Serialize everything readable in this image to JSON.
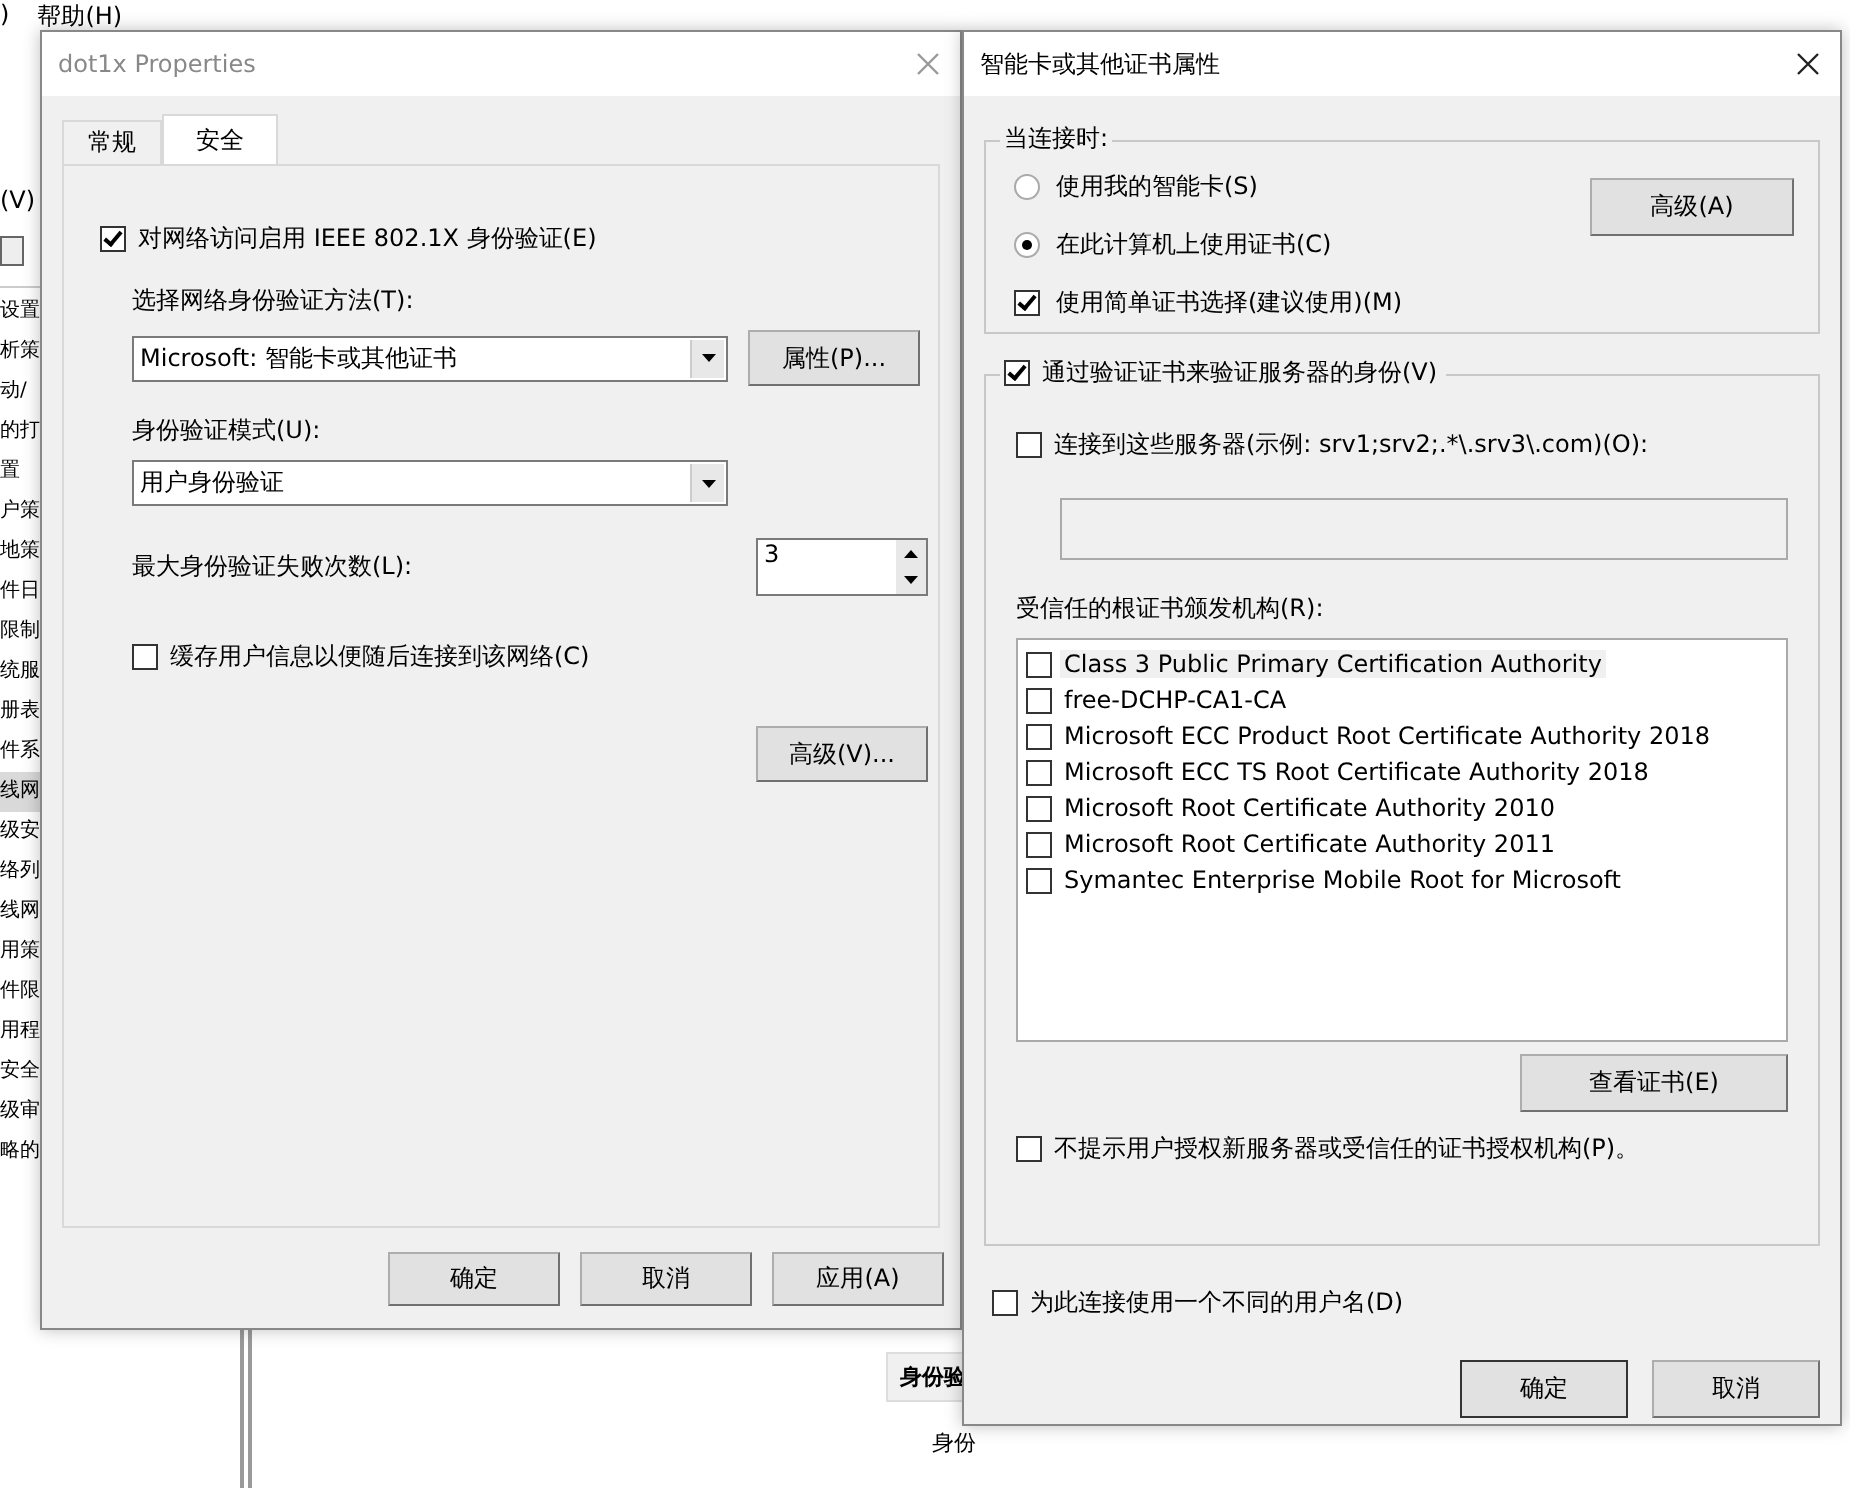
{
  "background_window": {
    "menu": [
      ")",
      "帮助(H)"
    ],
    "view_menu": "(V)",
    "tree_items": [
      {
        "label": "设置",
        "selected": false
      },
      {
        "label": "析策",
        "selected": false
      },
      {
        "label": "动/",
        "selected": false
      },
      {
        "label": "的打",
        "selected": false
      },
      {
        "label": "置",
        "selected": false
      },
      {
        "label": "户策",
        "selected": false
      },
      {
        "label": "地策",
        "selected": false
      },
      {
        "label": "件日",
        "selected": false
      },
      {
        "label": "限制",
        "selected": false
      },
      {
        "label": "统服",
        "selected": false
      },
      {
        "label": "册表",
        "selected": false
      },
      {
        "label": "件系",
        "selected": false
      },
      {
        "label": "线网",
        "selected": true
      },
      {
        "label": "级安",
        "selected": false
      },
      {
        "label": "络列",
        "selected": false
      },
      {
        "label": "线网",
        "selected": false
      },
      {
        "label": "用策",
        "selected": false
      },
      {
        "label": "件限",
        "selected": false
      },
      {
        "label": "用程",
        "selected": false
      },
      {
        "label": "安全",
        "selected": false
      },
      {
        "label": "级审",
        "selected": false
      },
      {
        "label": "略的",
        "selected": false
      }
    ],
    "table_header": "身份验",
    "table_cell": "身份"
  },
  "dialog1": {
    "title": "dot1x Properties",
    "tabs": [
      {
        "label": "常规",
        "selected": false
      },
      {
        "label": "安全",
        "selected": true
      }
    ],
    "enable_8021x": {
      "label": "对网络访问启用 IEEE 802.1X 身份验证(E)",
      "checked": true
    },
    "method_label": "选择网络身份验证方法(T):",
    "method_select": {
      "value": "Microsoft: 智能卡或其他证书"
    },
    "properties_button": "属性(P)...",
    "mode_label": "身份验证模式(U):",
    "mode_select": {
      "value": "用户身份验证"
    },
    "max_failures_label": "最大身份验证失败次数(L):",
    "max_failures": {
      "value": "3"
    },
    "cache_user_info": {
      "label": "缓存用户信息以便随后连接到该网络(C)",
      "checked": false
    },
    "advanced_button": "高级(V)...",
    "buttons": [
      "确定",
      "取消",
      "应用(A)"
    ]
  },
  "dialog2": {
    "title": "智能卡或其他证书属性",
    "when_connecting": {
      "legend": "当连接时:",
      "options": [
        {
          "label": "使用我的智能卡(S)",
          "selected": false
        },
        {
          "label": "在此计算机上使用证书(C)",
          "selected": true
        }
      ],
      "simple_cert": {
        "label": "使用简单证书选择(建议使用)(M)",
        "checked": true
      },
      "advanced_button": "高级(A)"
    },
    "verify_server": {
      "label": "通过验证证书来验证服务器的身份(V)",
      "checked": true
    },
    "connect_servers": {
      "label": "连接到这些服务器(示例: srv1;srv2;.*\\.srv3\\.com)(O):",
      "checked": false
    },
    "trusted_label": "受信任的根证书颁发机构(R):",
    "trusted_cas": [
      {
        "label": "Class 3 Public Primary Certification Authority",
        "checked": false,
        "selected": true
      },
      {
        "label": "free-DCHP-CA1-CA",
        "checked": false,
        "selected": false
      },
      {
        "label": "Microsoft ECC Product Root Certificate Authority 2018",
        "checked": false,
        "selected": false
      },
      {
        "label": "Microsoft ECC TS Root Certificate Authority 2018",
        "checked": false,
        "selected": false
      },
      {
        "label": "Microsoft Root Certificate Authority 2010",
        "checked": false,
        "selected": false
      },
      {
        "label": "Microsoft Root Certificate Authority 2011",
        "checked": false,
        "selected": false
      },
      {
        "label": "Symantec Enterprise Mobile Root for Microsoft",
        "checked": false,
        "selected": false
      }
    ],
    "view_cert_button": "查看证书(E)",
    "no_prompt": {
      "label": "不提示用户授权新服务器或受信任的证书授权机构(P)。",
      "checked": false
    },
    "different_user": {
      "label": "为此连接使用一个不同的用户名(D)",
      "checked": false
    },
    "buttons": [
      "确定",
      "取消"
    ]
  }
}
